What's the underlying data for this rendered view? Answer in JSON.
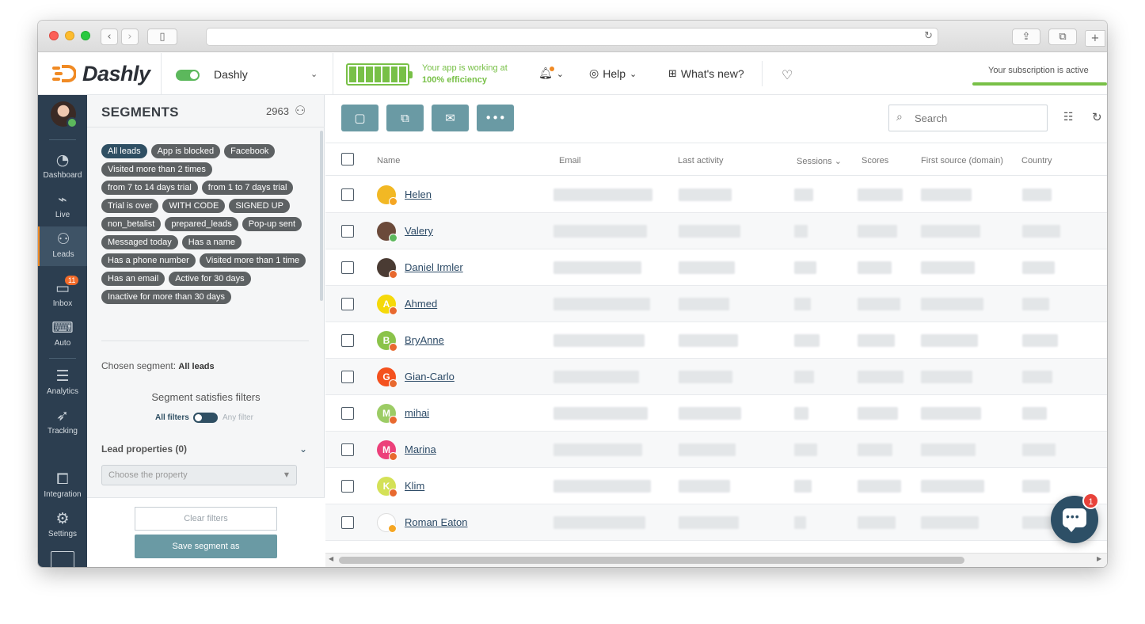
{
  "header": {
    "logo_text": "Dashly",
    "project_name": "Dashly",
    "efficiency_line1": "Your app is working at",
    "efficiency_line2": "100% efficiency",
    "help_label": "Help",
    "whats_new_label": "What's new?",
    "subscription_text": "Your subscription is active"
  },
  "leftnav": {
    "items": [
      {
        "label": "Dashboard",
        "icon": "speedometer-icon"
      },
      {
        "label": "Live",
        "icon": "pulse-monitor-icon"
      },
      {
        "label": "Leads",
        "icon": "users-icon"
      },
      {
        "label": "Inbox",
        "icon": "chat-icon",
        "badge": "11"
      },
      {
        "label": "Auto",
        "icon": "auto-message-icon"
      },
      {
        "label": "Analytics",
        "icon": "funnel-icon"
      },
      {
        "label": "Tracking",
        "icon": "cursor-icon"
      },
      {
        "label": "Integration",
        "icon": "puzzle-icon"
      },
      {
        "label": "Settings",
        "icon": "gear-icon"
      }
    ]
  },
  "segments": {
    "title": "SEGMENTS",
    "count": "2963",
    "tags": [
      "All leads",
      "App is blocked",
      "Facebook",
      "Visited more than 2 times",
      "from 7 to 14 days trial",
      "from 1 to 7 days trial",
      "Trial is over",
      "WITH CODE",
      "SIGNED UP",
      "non_betalist",
      "prepared_leads",
      "Pop-up sent",
      "Messaged today",
      "Has a name",
      "Has a phone number",
      "Visited more than 1 time",
      "Has an email",
      "Active for 30 days",
      "Inactive for more than 30 days"
    ],
    "selected_tag": "All leads",
    "chosen_label": "Chosen segment:",
    "chosen_value": "All leads",
    "satisfies_label": "Segment satisfies filters",
    "all_filters_label": "All filters",
    "any_filter_label": "Any filter",
    "lead_properties_label": "Lead properties (0)",
    "property_placeholder": "Choose the property",
    "clear_label": "Clear filters",
    "save_label": "Save segment as"
  },
  "toolbar": {
    "search_placeholder": "Search"
  },
  "table": {
    "columns": [
      "Name",
      "Email",
      "Last activity",
      "Sessions",
      "Scores",
      "First source (domain)",
      "Country"
    ],
    "rows": [
      {
        "name": "Helen",
        "avatar_letter": "",
        "avatar_color": "#f2b824",
        "status_color": "#f5a623"
      },
      {
        "name": "Valery",
        "avatar_letter": "",
        "avatar_color": "#6b4a3a",
        "status_color": "#5cb85c"
      },
      {
        "name": "Daniel Irmler",
        "avatar_letter": "",
        "avatar_color": "#4a3b33",
        "status_color": "#e8692f"
      },
      {
        "name": "Ahmed",
        "avatar_letter": "A",
        "avatar_color": "#f5d90a",
        "status_color": "#e8692f"
      },
      {
        "name": "BryAnne",
        "avatar_letter": "B",
        "avatar_color": "#8bc34a",
        "status_color": "#e8692f"
      },
      {
        "name": "Gian-Carlo",
        "avatar_letter": "G",
        "avatar_color": "#f4511e",
        "status_color": "#e8692f"
      },
      {
        "name": "mihai",
        "avatar_letter": "M",
        "avatar_color": "#9ccc65",
        "status_color": "#e8692f"
      },
      {
        "name": "Marina",
        "avatar_letter": "M",
        "avatar_color": "#ec407a",
        "status_color": "#e8692f"
      },
      {
        "name": "Klim",
        "avatar_letter": "K",
        "avatar_color": "#d4e157",
        "status_color": "#e8692f"
      },
      {
        "name": "Roman Eaton",
        "avatar_letter": "",
        "avatar_color": "#ffffff",
        "status_color": "#f5a623"
      }
    ]
  },
  "chat": {
    "badge": "1"
  }
}
